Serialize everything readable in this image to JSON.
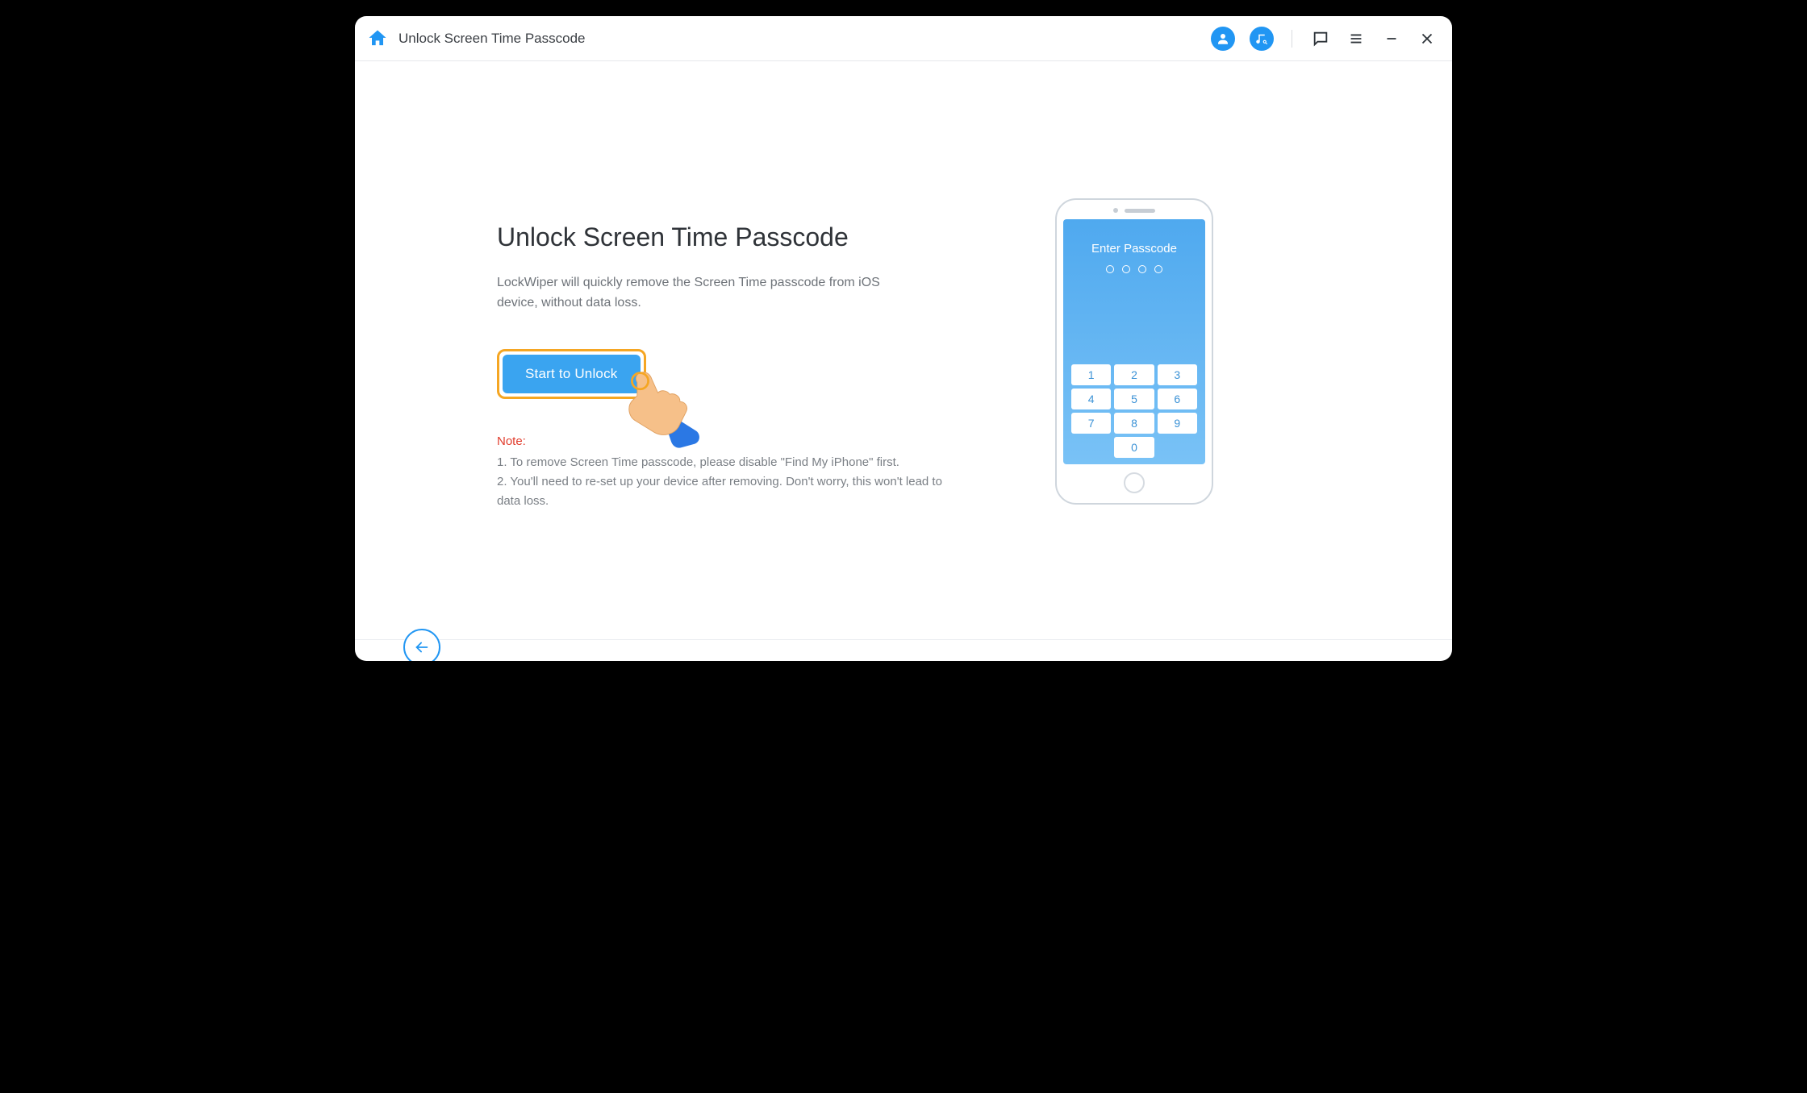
{
  "titlebar": {
    "title": "Unlock Screen Time Passcode"
  },
  "main": {
    "heading": "Unlock Screen Time Passcode",
    "description": "LockWiper will quickly remove the Screen Time passcode from iOS device, without data loss.",
    "cta_label": "Start to Unlock",
    "note_label": "Note:",
    "note_line1": "1. To remove Screen Time passcode, please disable \"Find My iPhone\" first.",
    "note_line2": "2. You'll need to re-set up your device after removing. Don't worry, this won't lead to data loss."
  },
  "phone": {
    "screen_title": "Enter Passcode",
    "keys": [
      "1",
      "2",
      "3",
      "4",
      "5",
      "6",
      "7",
      "8",
      "9",
      "0"
    ]
  },
  "colors": {
    "accent": "#2196f3",
    "highlight": "#f5a623",
    "danger": "#e13b2b"
  }
}
